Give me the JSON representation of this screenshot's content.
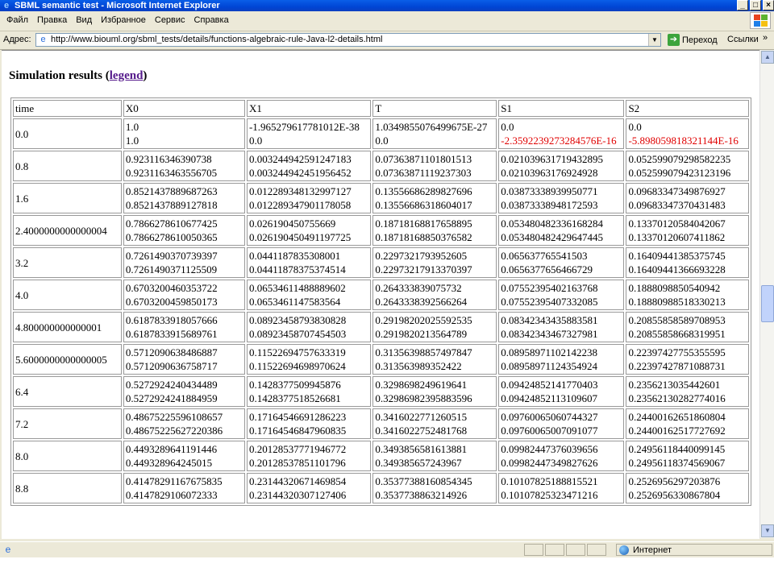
{
  "window": {
    "title": "SBML semantic test - Microsoft Internet Explorer",
    "buttons": [
      "_",
      "□",
      "×"
    ]
  },
  "menu": {
    "items": [
      "Файл",
      "Правка",
      "Вид",
      "Избранное",
      "Сервис",
      "Справка"
    ]
  },
  "address": {
    "label": "Адрес:",
    "url": "http://www.biouml.org/sbml_tests/details/functions-algebraic-rule-Java-l2-details.html",
    "go_label": "Переход",
    "links_label": "Ссылки",
    "links_arrow": "»"
  },
  "page": {
    "heading_prefix": "Simulation results (",
    "heading_link": "legend",
    "heading_suffix": ")"
  },
  "table": {
    "headers": [
      "time",
      "X0",
      "X1",
      "T",
      "S1",
      "S2"
    ],
    "rows": [
      {
        "time": "0.0",
        "cells": [
          [
            "1.0",
            "1.0"
          ],
          [
            "-1.965279617781012E-38",
            "0.0"
          ],
          [
            "1.0349855076499675E-27",
            "0.0"
          ],
          [
            "0.0",
            "-2.3592239273284576E-16"
          ],
          [
            "0.0",
            "-5.898059818321144E-16"
          ]
        ],
        "errors": [
          false,
          false,
          false,
          true,
          true
        ]
      },
      {
        "time": "0.8",
        "cells": [
          [
            "0.923116346390738",
            "0.9231163463556705"
          ],
          [
            "0.003244942591247183",
            "0.003244942451956452"
          ],
          [
            "0.07363871101801513",
            "0.07363871119237303"
          ],
          [
            "0.021039631719432895",
            "0.02103963176924928"
          ],
          [
            "0.052599079298582235",
            "0.052599079423123196"
          ]
        ]
      },
      {
        "time": "1.6",
        "cells": [
          [
            "0.8521437889687263",
            "0.8521437889127818"
          ],
          [
            "0.012289348132997127",
            "0.012289347901178058"
          ],
          [
            "0.13556686289827696",
            "0.13556686318604017"
          ],
          [
            "0.03873338939950771",
            "0.03873338948172593"
          ],
          [
            "0.09683347349876927",
            "0.09683347370431483"
          ]
        ]
      },
      {
        "time": "2.4000000000000004",
        "cells": [
          [
            "0.7866278610677425",
            "0.7866278610050365"
          ],
          [
            "0.026190450755669",
            "0.026190450491197725"
          ],
          [
            "0.18718168817658895",
            "0.18718168850376582"
          ],
          [
            "0.053480482336168284",
            "0.053480482429647445"
          ],
          [
            "0.13370120584042067",
            "0.13370120607411862"
          ]
        ]
      },
      {
        "time": "3.2",
        "cells": [
          [
            "0.7261490370739397",
            "0.7261490371125509"
          ],
          [
            "0.0441187835308001",
            "0.04411878375374514"
          ],
          [
            "0.2297321793952605",
            "0.22973217913370397"
          ],
          [
            "0.065637765541503",
            "0.0656377656466729"
          ],
          [
            "0.16409441385375745",
            "0.16409441366693228"
          ]
        ]
      },
      {
        "time": "4.0",
        "cells": [
          [
            "0.6703200460353722",
            "0.6703200459850173"
          ],
          [
            "0.06534611488889602",
            "0.0653461147583564"
          ],
          [
            "0.264333839075732",
            "0.2643338392566264"
          ],
          [
            "0.07552395402163768",
            "0.07552395407332085"
          ],
          [
            "0.1888098850540942",
            "0.18880988518330213"
          ]
        ]
      },
      {
        "time": "4.800000000000001",
        "cells": [
          [
            "0.6187833918057666",
            "0.6187833915689761"
          ],
          [
            "0.08923458793830828",
            "0.08923458707454503"
          ],
          [
            "0.29198202025592535",
            "0.2919820213564789"
          ],
          [
            "0.08342343435883581",
            "0.08342343467327981"
          ],
          [
            "0.20855858589708953",
            "0.20855858668319951"
          ]
        ]
      },
      {
        "time": "5.6000000000000005",
        "cells": [
          [
            "0.5712090638486887",
            "0.5712090636758717"
          ],
          [
            "0.11522694757633319",
            "0.11522694698970624"
          ],
          [
            "0.31356398857497847",
            "0.313563989352422"
          ],
          [
            "0.08958971102142238",
            "0.08958971124354924"
          ],
          [
            "0.22397427755355595",
            "0.22397427871088731"
          ]
        ]
      },
      {
        "time": "6.4",
        "cells": [
          [
            "0.5272924240434489",
            "0.5272924241884959"
          ],
          [
            "0.1428377509945876",
            "0.1428377518526681"
          ],
          [
            "0.3298698249619641",
            "0.32986982395883596"
          ],
          [
            "0.09424852141770403",
            "0.09424852113109607"
          ],
          [
            "0.2356213035442601",
            "0.23562130282774016"
          ]
        ]
      },
      {
        "time": "7.2",
        "cells": [
          [
            "0.48675225596108657",
            "0.48675225627220386"
          ],
          [
            "0.17164546691286223",
            "0.17164546847960835"
          ],
          [
            "0.3416022771260515",
            "0.3416022752481768"
          ],
          [
            "0.09760065060744327",
            "0.09760065007091077"
          ],
          [
            "0.24400162651860804",
            "0.24400162517727692"
          ]
        ]
      },
      {
        "time": "8.0",
        "cells": [
          [
            "0.4493289641191446",
            "0.449328964245015"
          ],
          [
            "0.20128537771946772",
            "0.20128537851101796"
          ],
          [
            "0.3493856581613881",
            "0.349385657243967"
          ],
          [
            "0.09982447376039656",
            "0.09982447349827626"
          ],
          [
            "0.24956118440099145",
            "0.24956118374569067"
          ]
        ]
      },
      {
        "time": "8.8",
        "cells": [
          [
            "0.41478291167675835",
            "0.4147829106072333"
          ],
          [
            "0.23144320671469854",
            "0.23144320307127406"
          ],
          [
            "0.35377388160854345",
            "0.3537738863214926"
          ],
          [
            "0.10107825188815521",
            "0.10107825323471216"
          ],
          [
            "0.2526956297203876",
            "0.2526956330867804"
          ]
        ]
      }
    ]
  },
  "status": {
    "zone_label": "Интернет"
  },
  "colors": {
    "titlebar": "#0a5ee8",
    "error_text": "#e00000",
    "link_visited": "#551a8b"
  }
}
